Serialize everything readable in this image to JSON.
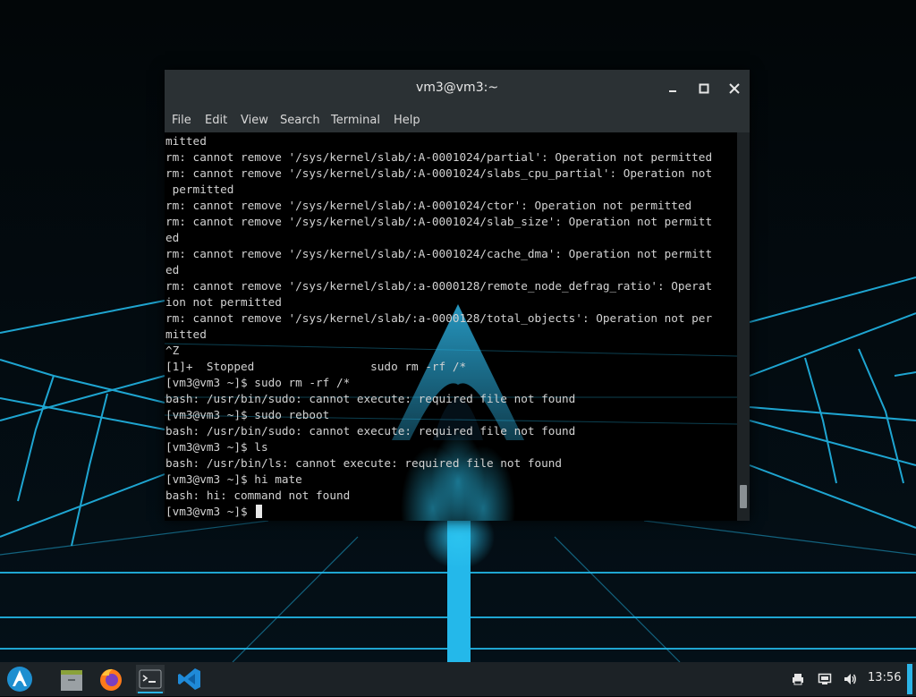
{
  "window": {
    "title": "vm3@vm3:~",
    "controls": {
      "minimize": "minimize-icon",
      "maximize": "maximize-icon",
      "close": "close-icon"
    },
    "menu": [
      "File",
      "Edit",
      "View",
      "Search",
      "Terminal",
      "Help"
    ]
  },
  "terminal": {
    "lines": [
      "mitted",
      "rm: cannot remove '/sys/kernel/slab/:A-0001024/partial': Operation not permitted",
      "rm: cannot remove '/sys/kernel/slab/:A-0001024/slabs_cpu_partial': Operation not",
      " permitted",
      "rm: cannot remove '/sys/kernel/slab/:A-0001024/ctor': Operation not permitted",
      "rm: cannot remove '/sys/kernel/slab/:A-0001024/slab_size': Operation not permitt",
      "ed",
      "rm: cannot remove '/sys/kernel/slab/:A-0001024/cache_dma': Operation not permitt",
      "ed",
      "rm: cannot remove '/sys/kernel/slab/:a-0000128/remote_node_defrag_ratio': Operat",
      "ion not permitted",
      "rm: cannot remove '/sys/kernel/slab/:a-0000128/total_objects': Operation not per",
      "mitted",
      "^Z",
      "[1]+  Stopped                 sudo rm -rf /*",
      "[vm3@vm3 ~]$ sudo rm -rf /*",
      "bash: /usr/bin/sudo: cannot execute: required file not found",
      "[vm3@vm3 ~]$ sudo reboot",
      "bash: /usr/bin/sudo: cannot execute: required file not found",
      "[vm3@vm3 ~]$ ls",
      "bash: /usr/bin/ls: cannot execute: required file not found",
      "[vm3@vm3 ~]$ hi mate",
      "bash: hi: command not found"
    ],
    "prompt": "[vm3@vm3 ~]$ ",
    "scroll_position": 0.97
  },
  "taskbar": {
    "launchers": [
      "arch-logo-icon",
      "file-manager-icon",
      "firefox-icon",
      "terminal-icon",
      "vscode-icon"
    ],
    "tray": [
      "printer-icon",
      "network-icon",
      "volume-icon"
    ],
    "clock": "13:56"
  },
  "colors": {
    "accent": "#2cb5e8",
    "terminal_text": "#d2d2d2",
    "titlebar": "#2b3134",
    "taskbar": "#1c2226"
  }
}
